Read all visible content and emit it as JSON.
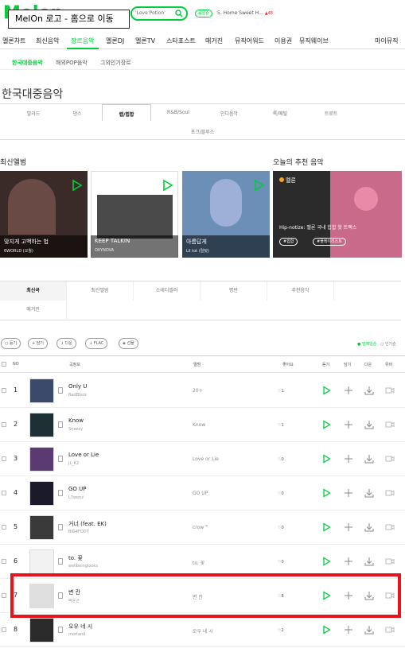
{
  "header": {
    "logo_text": "Melon",
    "tooltip": "MelOn 로고 - 홈으로 이동",
    "search_placeholder": "'Love Potion'",
    "chip": "음원순",
    "now_playing": "5. Home Sweet H...",
    "now_playing_badge": "▲48"
  },
  "gnb": [
    "멜론차트",
    "최신음악",
    "장르음악",
    "멜론DJ",
    "멜론TV",
    "스타포스트",
    "매거진",
    "뮤직어워드",
    "이용권",
    "뮤직웨이브",
    "마이뮤직"
  ],
  "subnav": [
    "한국대중음악",
    "해외POP음악",
    "그외인기장르"
  ],
  "page_title": "한국대중음악",
  "genres": [
    "발라드",
    "댄스",
    "랩/힙합",
    "R&B/Soul",
    "인디음악",
    "록/메탈",
    "트로트"
  ],
  "genre_row2": "포크/블루스",
  "sections": {
    "latest": "최신앨범",
    "reco": "오늘의 추천 음악"
  },
  "albums": [
    {
      "name": "맞지게 고백하는 법",
      "artist": "6WORLD (오월)",
      "color": "#3a2a28"
    },
    {
      "name": "KEEP TALKIN",
      "artist": "OXYNOVA",
      "color": "#4a4a4a"
    },
    {
      "name": "아름답게",
      "artist": "Lil tot (릴텃)",
      "color": "#6c8fb8"
    }
  ],
  "reco": {
    "tag": "멜론",
    "title": "Hip-notize: 멜론 국내 힙합 핫 트랙스",
    "btn1": "#힙합",
    "btn2": "#플레이리스트"
  },
  "tabs": [
    "최신곡",
    "최신앨범",
    "스테디셀러",
    "명반",
    "추천음악",
    "매거진"
  ],
  "actions": [
    "듣기",
    "담기",
    "다운",
    "FLAC",
    "선물"
  ],
  "sort": [
    "발매일순",
    "인기순"
  ],
  "table_headers": {
    "no": "NO",
    "song": "곡정보",
    "album": "앨범",
    "like": "좋아요",
    "listen": "듣기",
    "add": "담기",
    "down": "다운",
    "mv": "뮤비"
  },
  "songs": [
    {
      "rank": "1",
      "title": "Only U",
      "artist": "BadBlock",
      "album": "20+",
      "likes": "1",
      "thumb": "#3b4a6a"
    },
    {
      "rank": "2",
      "title": "Know",
      "artist": "Sneezy",
      "album": "Know",
      "likes": "1",
      "thumb": "#1d2f33"
    },
    {
      "rank": "3",
      "title": "Love or Lie",
      "artist": "JL_K2",
      "album": "Love or Lie",
      "likes": "0",
      "thumb": "#5a3a70"
    },
    {
      "rank": "4",
      "title": "GO UP",
      "artist": "L7wonz",
      "album": "GO UP",
      "likes": "0",
      "thumb": "#1a1a2a"
    },
    {
      "rank": "5",
      "title": "거너 (feat. EK)",
      "artist": "BIG4FOOT",
      "album": "crow™",
      "likes": "0",
      "thumb": "#3a3a3a"
    },
    {
      "rank": "6",
      "title": "to. 꽃",
      "artist": "wellbeinglooks",
      "album": "to. 꽃",
      "likes": "0",
      "thumb": "#f2f2f2"
    },
    {
      "rank": "7",
      "title": "변 칸",
      "artist": "박윤근",
      "album": "변 칸",
      "likes": "8",
      "thumb": "#dedede"
    },
    {
      "rank": "8",
      "title": "오우 네 시",
      "artist": "mortand",
      "album": "오우 네 시",
      "likes": "2",
      "thumb": "#2a2a2a"
    }
  ],
  "colors": {
    "accent": "#00cd3c",
    "highlight": "#e8131b"
  }
}
